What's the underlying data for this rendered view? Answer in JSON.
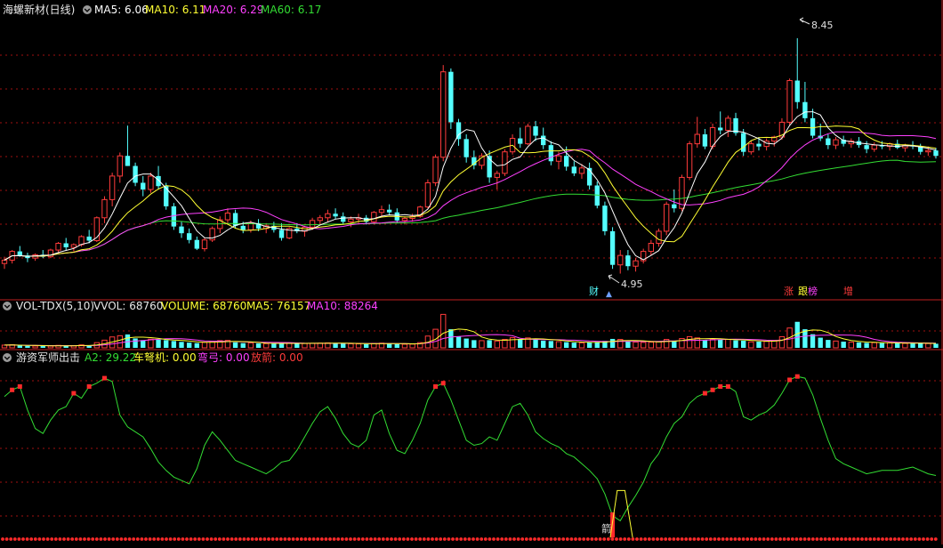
{
  "main_header": {
    "title": "海螺新材(日线)",
    "ma5": "MA5: 6.06",
    "ma10": "MA10: 6.11",
    "ma20": "MA20: 6.29",
    "ma60": "MA60: 6.17"
  },
  "vol_header": {
    "title": "VOL-TDX(5,10)",
    "vvol": "VVOL: 68760",
    "volume": "VOLUME: 68760",
    "ma5": "MA5: 76157",
    "ma10": "MA10: 88264"
  },
  "ind_header": {
    "title": "游资军师出击",
    "a2": "A2: 29.22",
    "chenuji": "车弩机: 0.00",
    "wangong": "弯弓: 0.00",
    "fangjian": "放箭: 0.00"
  },
  "annotations": {
    "high": "8.45",
    "low": "4.95",
    "marker_cai": "财",
    "marker_up": "▲",
    "marker_zhang": "涨",
    "marker_gen": "跟",
    "marker_bang": "榜",
    "marker_zeng": "增",
    "marker_jian": "箭"
  },
  "colors": {
    "up": "#ff3b3b",
    "down": "#54ffff",
    "ma5": "#ffffff",
    "ma10": "#ffff33",
    "ma20": "#ff40ff",
    "ma60": "#33dd33",
    "grid": "#a01010"
  },
  "chart_data": {
    "type": "candlestick",
    "price_ylim": [
      4.6,
      8.7
    ],
    "volume_ylim": [
      0,
      280000
    ],
    "indicator_ylim": [
      -2,
      103
    ],
    "candles": [
      [
        5.1,
        5.2,
        5.02,
        5.15
      ],
      [
        5.15,
        5.3,
        5.1,
        5.28
      ],
      [
        5.28,
        5.36,
        5.2,
        5.22
      ],
      [
        5.22,
        5.26,
        5.12,
        5.18
      ],
      [
        5.18,
        5.25,
        5.14,
        5.23
      ],
      [
        5.23,
        5.3,
        5.18,
        5.2
      ],
      [
        5.2,
        5.32,
        5.18,
        5.3
      ],
      [
        5.3,
        5.42,
        5.26,
        5.4
      ],
      [
        5.4,
        5.48,
        5.3,
        5.34
      ],
      [
        5.34,
        5.4,
        5.28,
        5.38
      ],
      [
        5.38,
        5.52,
        5.35,
        5.5
      ],
      [
        5.5,
        5.6,
        5.4,
        5.44
      ],
      [
        5.44,
        5.8,
        5.42,
        5.78
      ],
      [
        5.78,
        6.1,
        5.7,
        6.05
      ],
      [
        6.05,
        6.45,
        5.95,
        6.4
      ],
      [
        6.4,
        6.75,
        6.3,
        6.7
      ],
      [
        6.7,
        7.15,
        6.55,
        6.55
      ],
      [
        6.55,
        6.6,
        6.25,
        6.3
      ],
      [
        6.3,
        6.4,
        6.1,
        6.2
      ],
      [
        6.2,
        6.45,
        6.15,
        6.4
      ],
      [
        6.4,
        6.55,
        6.2,
        6.25
      ],
      [
        6.25,
        6.3,
        5.9,
        5.95
      ],
      [
        5.95,
        6.0,
        5.6,
        5.65
      ],
      [
        5.65,
        5.72,
        5.48,
        5.55
      ],
      [
        5.55,
        5.62,
        5.4,
        5.45
      ],
      [
        5.45,
        5.5,
        5.3,
        5.32
      ],
      [
        5.32,
        5.48,
        5.28,
        5.45
      ],
      [
        5.45,
        5.65,
        5.42,
        5.62
      ],
      [
        5.62,
        5.8,
        5.55,
        5.75
      ],
      [
        5.75,
        5.92,
        5.7,
        5.85
      ],
      [
        5.85,
        5.9,
        5.62,
        5.66
      ],
      [
        5.66,
        5.72,
        5.55,
        5.6
      ],
      [
        5.6,
        5.74,
        5.56,
        5.7
      ],
      [
        5.7,
        5.76,
        5.58,
        5.62
      ],
      [
        5.62,
        5.7,
        5.55,
        5.66
      ],
      [
        5.66,
        5.72,
        5.56,
        5.6
      ],
      [
        5.6,
        5.7,
        5.44,
        5.48
      ],
      [
        5.48,
        5.64,
        5.46,
        5.62
      ],
      [
        5.62,
        5.7,
        5.55,
        5.58
      ],
      [
        5.58,
        5.66,
        5.5,
        5.64
      ],
      [
        5.64,
        5.78,
        5.6,
        5.74
      ],
      [
        5.74,
        5.82,
        5.68,
        5.78
      ],
      [
        5.78,
        5.9,
        5.72,
        5.84
      ],
      [
        5.84,
        5.92,
        5.76,
        5.8
      ],
      [
        5.8,
        5.86,
        5.68,
        5.72
      ],
      [
        5.72,
        5.8,
        5.64,
        5.76
      ],
      [
        5.76,
        5.84,
        5.7,
        5.78
      ],
      [
        5.78,
        5.82,
        5.68,
        5.72
      ],
      [
        5.72,
        5.88,
        5.68,
        5.86
      ],
      [
        5.86,
        5.96,
        5.8,
        5.9
      ],
      [
        5.9,
        5.98,
        5.82,
        5.86
      ],
      [
        5.86,
        5.92,
        5.7,
        5.74
      ],
      [
        5.74,
        5.8,
        5.68,
        5.77
      ],
      [
        5.77,
        5.84,
        5.72,
        5.8
      ],
      [
        5.8,
        5.96,
        5.78,
        5.94
      ],
      [
        5.94,
        6.35,
        5.92,
        6.3
      ],
      [
        6.3,
        6.72,
        6.25,
        6.68
      ],
      [
        6.68,
        8.05,
        6.62,
        7.95
      ],
      [
        7.95,
        8.0,
        7.1,
        7.2
      ],
      [
        7.2,
        7.25,
        6.85,
        6.95
      ],
      [
        6.95,
        7.02,
        6.6,
        6.68
      ],
      [
        6.68,
        6.78,
        6.5,
        6.56
      ],
      [
        6.56,
        6.74,
        6.5,
        6.7
      ],
      [
        6.7,
        6.78,
        6.3,
        6.38
      ],
      [
        6.38,
        6.48,
        6.2,
        6.44
      ],
      [
        6.44,
        6.8,
        6.4,
        6.76
      ],
      [
        6.76,
        7.02,
        6.72,
        6.96
      ],
      [
        6.96,
        7.12,
        6.82,
        6.88
      ],
      [
        6.88,
        7.18,
        6.86,
        7.14
      ],
      [
        7.14,
        7.22,
        6.92,
        7.0
      ],
      [
        7.0,
        7.12,
        6.8,
        6.86
      ],
      [
        6.86,
        6.92,
        6.56,
        6.62
      ],
      [
        6.62,
        6.76,
        6.5,
        6.7
      ],
      [
        6.7,
        6.84,
        6.48,
        6.54
      ],
      [
        6.54,
        6.62,
        6.4,
        6.44
      ],
      [
        6.44,
        6.58,
        6.36,
        6.52
      ],
      [
        6.52,
        6.6,
        6.2,
        6.26
      ],
      [
        6.26,
        6.32,
        5.92,
        5.96
      ],
      [
        5.96,
        6.02,
        5.52,
        5.58
      ],
      [
        5.58,
        5.64,
        5.02,
        5.08
      ],
      [
        5.08,
        5.3,
        4.95,
        5.22
      ],
      [
        5.22,
        5.3,
        5.0,
        5.06
      ],
      [
        5.06,
        5.18,
        4.98,
        5.14
      ],
      [
        5.14,
        5.32,
        5.1,
        5.28
      ],
      [
        5.28,
        5.45,
        5.22,
        5.4
      ],
      [
        5.4,
        5.62,
        5.35,
        5.58
      ],
      [
        5.58,
        6.02,
        5.52,
        5.98
      ],
      [
        5.98,
        6.2,
        5.86,
        5.92
      ],
      [
        5.92,
        6.42,
        5.88,
        6.38
      ],
      [
        6.38,
        6.92,
        6.34,
        6.88
      ],
      [
        6.88,
        7.28,
        6.82,
        7.02
      ],
      [
        7.02,
        7.1,
        6.8,
        6.84
      ],
      [
        6.84,
        7.18,
        6.8,
        7.12
      ],
      [
        7.12,
        7.36,
        7.02,
        7.08
      ],
      [
        7.08,
        7.3,
        6.98,
        7.26
      ],
      [
        7.26,
        7.34,
        7.0,
        7.04
      ],
      [
        7.04,
        7.1,
        6.7,
        6.76
      ],
      [
        6.76,
        6.92,
        6.72,
        6.88
      ],
      [
        6.88,
        6.98,
        6.78,
        6.84
      ],
      [
        6.84,
        6.96,
        6.78,
        6.92
      ],
      [
        6.92,
        7.0,
        6.84,
        6.98
      ],
      [
        6.98,
        7.26,
        6.94,
        7.2
      ],
      [
        7.2,
        7.85,
        7.16,
        7.82
      ],
      [
        7.82,
        8.45,
        7.4,
        7.5
      ],
      [
        7.5,
        7.8,
        7.2,
        7.26
      ],
      [
        7.26,
        7.4,
        6.96,
        7.0
      ],
      [
        7.0,
        7.18,
        6.92,
        6.96
      ],
      [
        6.96,
        7.02,
        6.8,
        6.86
      ],
      [
        6.86,
        6.98,
        6.8,
        6.94
      ],
      [
        6.94,
        7.0,
        6.84,
        6.88
      ],
      [
        6.88,
        6.96,
        6.82,
        6.92
      ],
      [
        6.92,
        6.98,
        6.82,
        6.86
      ],
      [
        6.86,
        6.92,
        6.74,
        6.8
      ],
      [
        6.8,
        6.9,
        6.76,
        6.86
      ],
      [
        6.86,
        6.92,
        6.8,
        6.84
      ],
      [
        6.84,
        6.9,
        6.78,
        6.88
      ],
      [
        6.88,
        6.94,
        6.8,
        6.82
      ],
      [
        6.82,
        6.88,
        6.76,
        6.86
      ],
      [
        6.86,
        6.92,
        6.8,
        6.84
      ],
      [
        6.84,
        6.88,
        6.72,
        6.76
      ],
      [
        6.76,
        6.84,
        6.7,
        6.78
      ],
      [
        6.78,
        6.82,
        6.66,
        6.7
      ]
    ],
    "volume": [
      22000,
      25000,
      18000,
      16000,
      15000,
      14000,
      15000,
      20000,
      17000,
      16000,
      24000,
      18000,
      42000,
      62000,
      88000,
      98000,
      108000,
      76000,
      62000,
      70000,
      66000,
      62000,
      55000,
      48000,
      42000,
      38000,
      44000,
      52000,
      58000,
      60000,
      44000,
      38000,
      40000,
      36000,
      34000,
      33000,
      38000,
      40000,
      34000,
      35000,
      36000,
      38000,
      40000,
      38000,
      34000,
      33000,
      32000,
      30000,
      36000,
      38000,
      34000,
      30000,
      29000,
      30000,
      42000,
      95000,
      150000,
      270000,
      150000,
      92000,
      75000,
      62000,
      58000,
      62000,
      55000,
      68000,
      82000,
      72000,
      80000,
      68000,
      58000,
      55000,
      50000,
      46000,
      42000,
      40000,
      44000,
      48000,
      56000,
      72000,
      68000,
      52000,
      46000,
      44000,
      46000,
      50000,
      68000,
      58000,
      75000,
      90000,
      80000,
      62000,
      70000,
      66000,
      68000,
      60000,
      58000,
      48000,
      50000,
      52000,
      60000,
      90000,
      160000,
      210000,
      150000,
      110000,
      82000,
      64000,
      55000,
      50000,
      46000,
      44000,
      40000,
      42000,
      38000,
      40000,
      38000,
      36000,
      35000,
      38000,
      35000,
      33000
    ],
    "indicator_a2": [
      84,
      88,
      90,
      76,
      65,
      62,
      70,
      76,
      78,
      86,
      83,
      90,
      92,
      95,
      93,
      73,
      66,
      63,
      60,
      53,
      45,
      40,
      36,
      34,
      32,
      41,
      55,
      63,
      58,
      52,
      46,
      44,
      42,
      40,
      38,
      41,
      45,
      46,
      52,
      60,
      68,
      75,
      78,
      71,
      62,
      56,
      54,
      58,
      73,
      76,
      62,
      52,
      50,
      58,
      68,
      82,
      90,
      92,
      82,
      70,
      58,
      55,
      56,
      60,
      58,
      68,
      78,
      80,
      73,
      63,
      59,
      56,
      54,
      50,
      48,
      44,
      40,
      35,
      26,
      13,
      10,
      18,
      25,
      33,
      44,
      50,
      60,
      68,
      72,
      80,
      84,
      86,
      88,
      90,
      90,
      87,
      72,
      70,
      73,
      75,
      79,
      86,
      94,
      96,
      95,
      85,
      71,
      58,
      47,
      44,
      42,
      40,
      38,
      39,
      40,
      40,
      40,
      41,
      42,
      40,
      38,
      37
    ]
  }
}
